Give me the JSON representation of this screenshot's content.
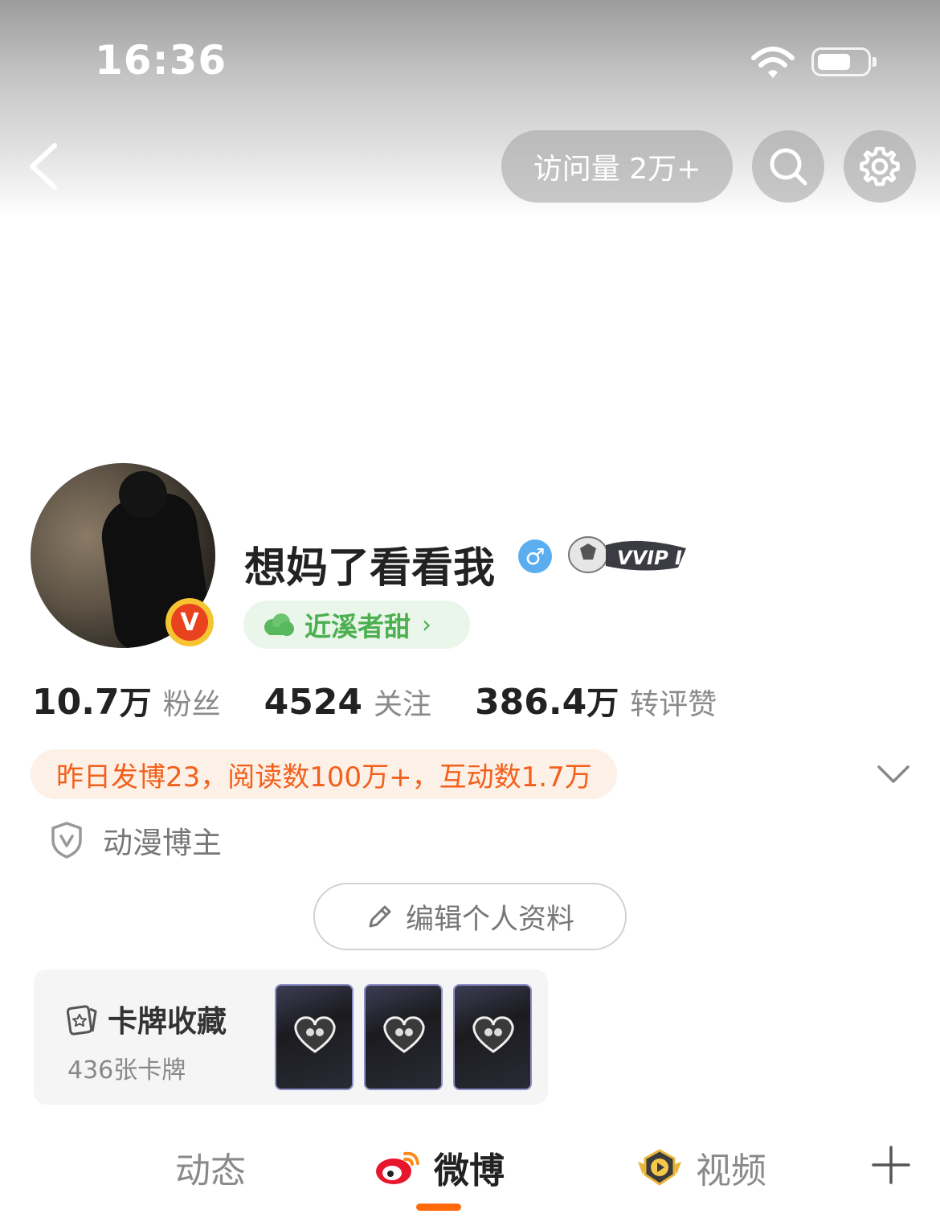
{
  "status_bar": {
    "time": "16:36",
    "icons": [
      "wifi-icon",
      "battery-icon"
    ]
  },
  "header": {
    "back_icon": "chevron-left-icon",
    "visits_label": "访问量 2万+",
    "search_icon": "search-icon",
    "settings_icon": "gear-icon"
  },
  "profile": {
    "username": "想妈了看看我",
    "gender_symbol": "♂",
    "vip_badge_text": "VVIP II",
    "verified_mark": "V",
    "group_label": "近溪者甜",
    "group_chevron": "›"
  },
  "stats": [
    {
      "number": "10.7",
      "unit": "万",
      "label": "粉丝"
    },
    {
      "number": "4524",
      "unit": "",
      "label": "关注"
    },
    {
      "number": "386.4",
      "unit": "万",
      "label": "转评赞"
    }
  ],
  "yesterday_summary": "昨日发博23，阅读数100万+，互动数1.7万",
  "category": {
    "label": "动漫博主",
    "icon": "shield-v-icon"
  },
  "edit_button": {
    "label": "编辑个人资料",
    "icon": "pencil-icon"
  },
  "card_collection": {
    "title": "卡牌收藏",
    "count": "436张卡牌",
    "icon": "card-star-icon"
  },
  "tabs": [
    {
      "label": "动态",
      "icon": ""
    },
    {
      "label": "微博",
      "icon": "weibo-logo-icon",
      "active": true
    },
    {
      "label": "视频",
      "icon": "video-badge-icon"
    }
  ],
  "colors": {
    "accent": "#ff6a0a",
    "summary_text": "#f2601c",
    "summary_bg": "#fdf0e6",
    "group_green": "#4caf50",
    "gender_blue": "#5aaef0"
  }
}
